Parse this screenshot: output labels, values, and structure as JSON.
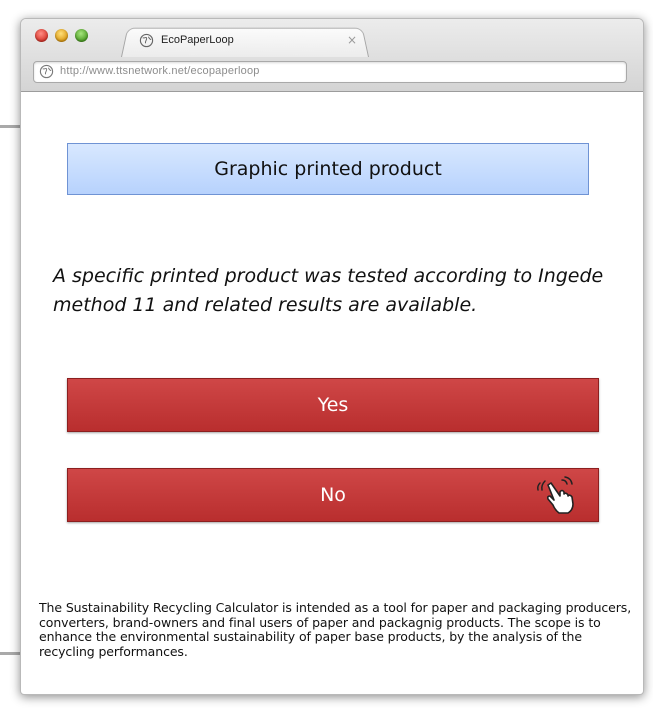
{
  "browser": {
    "tab_title": "EcoPaperLoop",
    "tab_close": "×",
    "url": "http://www.ttsnetwork.net/ecopaperloop"
  },
  "main": {
    "title": "Graphic printed product",
    "question": "A specific printed product was tested according to Ingede method 11 and related results are available.",
    "yes_label": "Yes",
    "no_label": "No"
  },
  "footer": {
    "description": "The Sustainability Recycling Calculator is intended as a tool for paper and packaging producers, converters, brand-owners and final users of paper and packagnig products. The scope is to enhance the environmental sustainability of paper base products, by the analysis of the recycling performances."
  },
  "icons": {
    "tab": "globe-icon",
    "address": "globe-icon",
    "cursor": "hand-pointer-icon"
  },
  "colors": {
    "title_bg": "#c6dcfe",
    "button_red": "#c43a3a",
    "text": "#111111"
  }
}
